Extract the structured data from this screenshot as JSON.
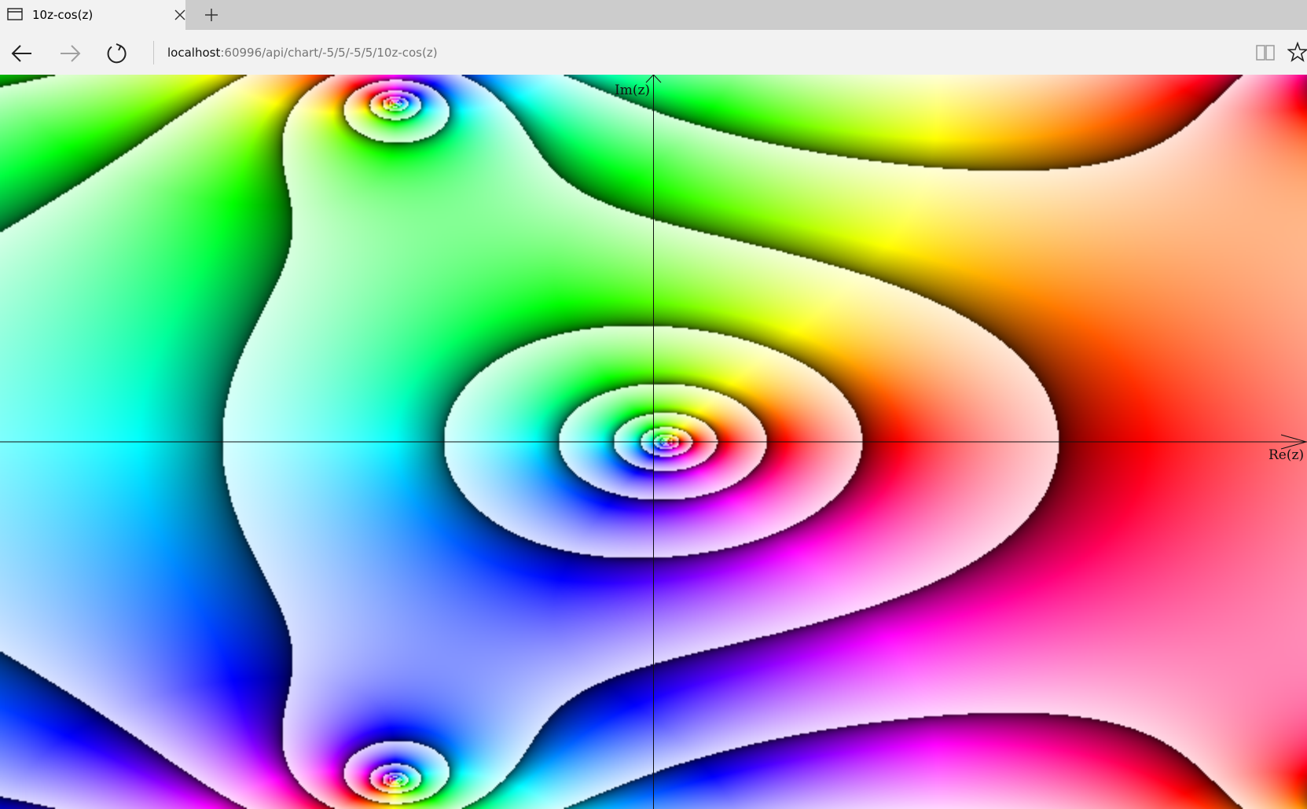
{
  "browser": {
    "tab": {
      "title": "10z-cos(z)",
      "icon": "page-icon",
      "close_icon": "close-icon"
    },
    "new_tab_icon": "plus-icon",
    "nav": {
      "back_icon": "back-arrow-icon",
      "forward_icon": "forward-arrow-icon",
      "refresh_icon": "refresh-icon",
      "reading_view_icon": "book-icon",
      "favorite_icon": "star-icon"
    },
    "address": {
      "host": "localhost",
      "path": ":60996/api/chart/-5/5/-5/5/10z-cos(z)"
    }
  },
  "chart_data": {
    "type": "heatmap",
    "function": "10z-cos(z)",
    "xlabel": "Re(z)",
    "ylabel": "Im(z)",
    "xlim": [
      -5,
      5
    ],
    "ylim": [
      -5,
      5
    ],
    "coloring": "domain coloring (hue = argument, shading = magnitude contours)",
    "axis_color": "#111111"
  }
}
